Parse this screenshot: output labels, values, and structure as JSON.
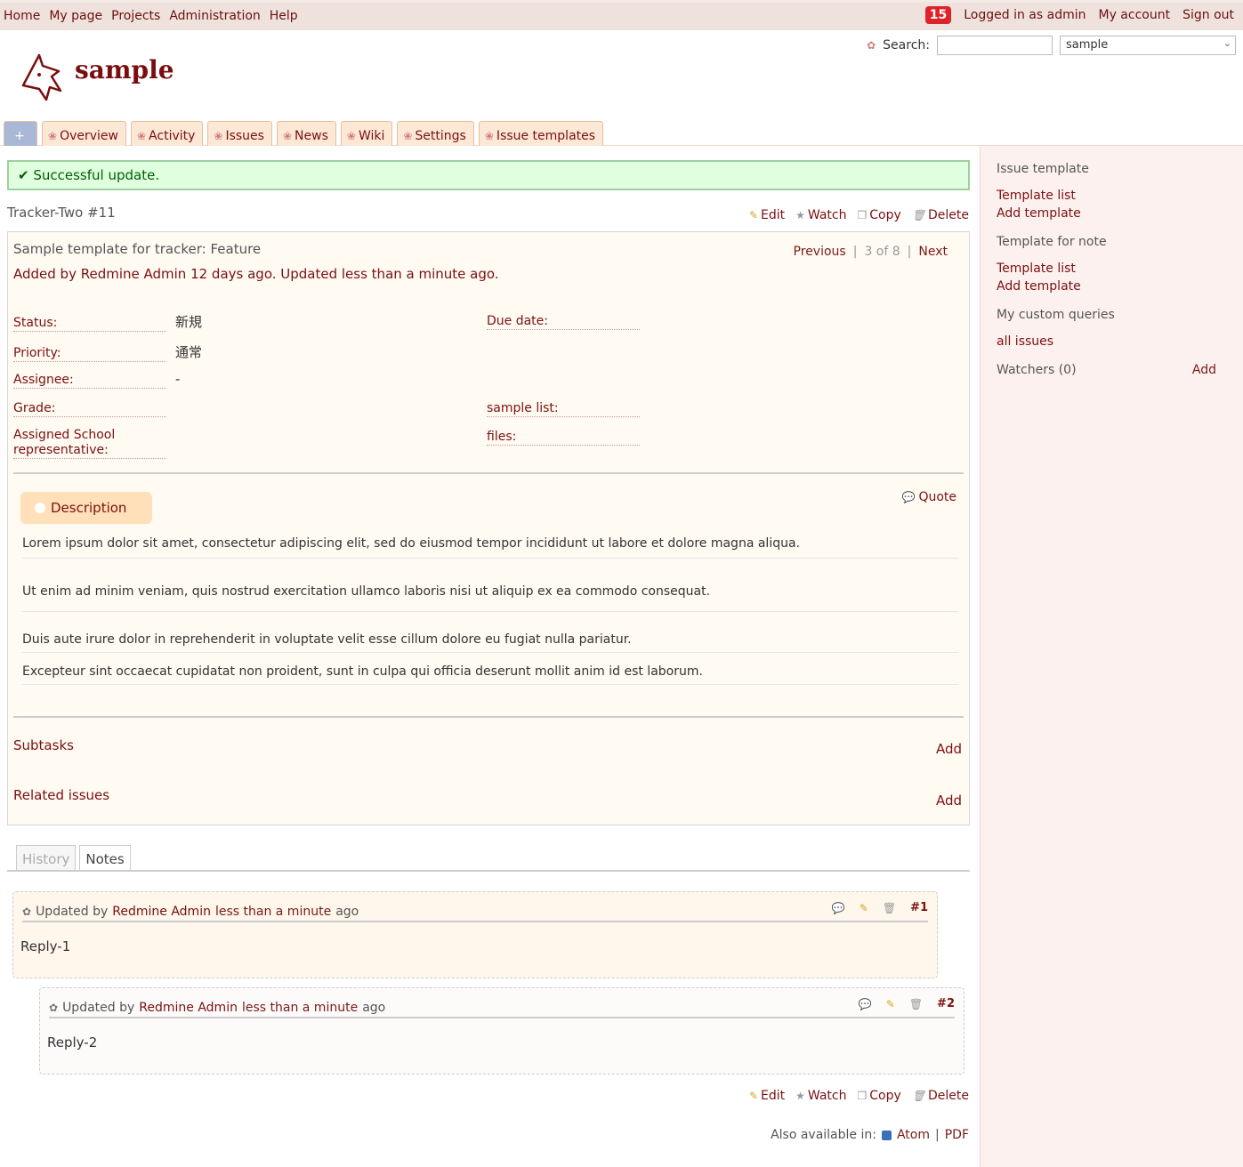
{
  "top_menu": {
    "items": [
      "Home",
      "My page",
      "Projects",
      "Administration",
      "Help"
    ],
    "badge": "15",
    "logged_in": "Logged in as admin",
    "my_account": "My account",
    "sign_out": "Sign out"
  },
  "header": {
    "project_title": "sample",
    "search_label": "Search:",
    "search_value": "",
    "project_select": "sample"
  },
  "tabs": [
    {
      "label": "Overview"
    },
    {
      "label": "Activity"
    },
    {
      "label": "Issues"
    },
    {
      "label": "News"
    },
    {
      "label": "Wiki"
    },
    {
      "label": "Settings"
    },
    {
      "label": "Issue templates"
    }
  ],
  "new_tab_label": "+",
  "flash": "Successful update.",
  "issue": {
    "id": "Tracker-Two #11",
    "actions": {
      "edit": "Edit",
      "watch": "Watch",
      "copy": "Copy",
      "delete": "Delete"
    },
    "subject": "Sample template for tracker: Feature",
    "author_line": "Added by Redmine Admin 12 days ago. Updated less than a minute ago.",
    "nav": {
      "previous": "Previous",
      "position": "3 of 8",
      "next": "Next"
    },
    "attributes": {
      "status_label": "Status:",
      "status_value": "新規",
      "priority_label": "Priority:",
      "priority_value": "通常",
      "assignee_label": "Assignee:",
      "assignee_value": "-",
      "grade_label": "Grade:",
      "grade_value": "",
      "school_label_1": "Assigned School",
      "school_label_2": "representative:",
      "due_label": "Due date:",
      "due_value": "",
      "sample_list_label": "sample list:",
      "sample_list_value": "",
      "files_label": "files:",
      "files_value": ""
    },
    "description_label": "Description",
    "quote_label": "Quote",
    "description": [
      "Lorem ipsum dolor sit amet, consectetur adipiscing elit, sed do eiusmod tempor incididunt ut labore et dolore magna aliqua.",
      "Ut enim ad minim veniam, quis nostrud exercitation ullamco laboris nisi ut aliquip ex ea commodo consequat.",
      "Duis aute irure dolor in reprehenderit in voluptate velit esse cillum dolore eu fugiat nulla pariatur.",
      "Excepteur sint occaecat cupidatat non proident, sunt in culpa qui officia deserunt mollit anim id est laborum."
    ],
    "subtasks_label": "Subtasks",
    "related_label": "Related issues",
    "add_label": "Add"
  },
  "history": {
    "tab_history": "History",
    "tab_notes": "Notes",
    "journals": [
      {
        "prefix": "Updated by",
        "author": "Redmine Admin",
        "time": "less than a minute",
        "suffix": "ago",
        "number": "#1",
        "body": "Reply-1"
      },
      {
        "prefix": "Updated by",
        "author": "Redmine Admin",
        "time": "less than a minute",
        "suffix": "ago",
        "number": "#2",
        "body": "Reply-2"
      }
    ]
  },
  "footer": {
    "also_available": "Also available in:",
    "atom": "Atom",
    "pdf": "PDF"
  },
  "sidebar": {
    "issue_template_title": "Issue template",
    "issue_template_links": [
      "Template list",
      "Add template"
    ],
    "note_template_title": "Template for note",
    "note_template_links": [
      "Template list",
      "Add template"
    ],
    "queries_title": "My custom queries",
    "queries": [
      "all issues"
    ],
    "watchers": "Watchers (0)",
    "watchers_add": "Add"
  },
  "colors": {
    "link": "#7a1010",
    "header_bg": "#efe2dc",
    "sidebar_bg": "#fdf1ef",
    "flash_bg": "#dfffdf",
    "badge": "#e0232a"
  }
}
